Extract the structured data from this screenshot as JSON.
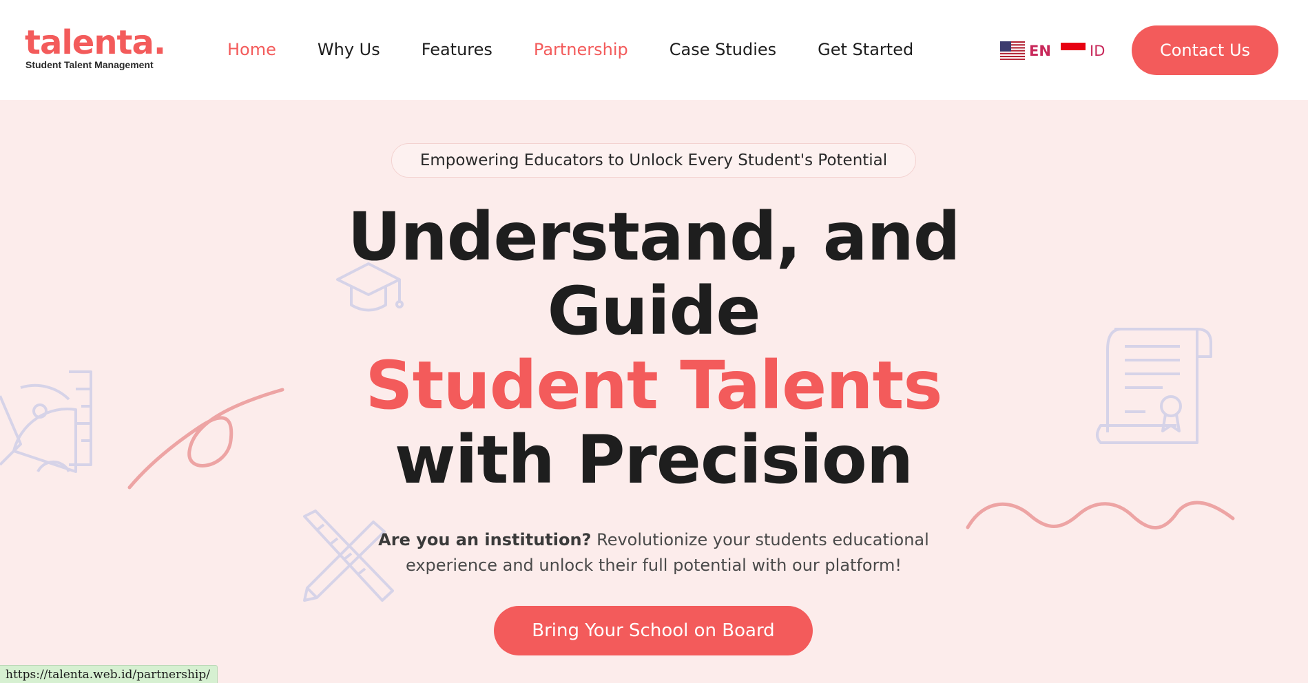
{
  "brand": {
    "name": "talenta.",
    "tagline": "Student Talent Management",
    "accent_color": "#f35b5b",
    "background_color": "#fceceb"
  },
  "nav": {
    "items": [
      {
        "label": "Home",
        "active": true
      },
      {
        "label": "Why Us",
        "active": false
      },
      {
        "label": "Features",
        "active": false
      },
      {
        "label": "Partnership",
        "active": true
      },
      {
        "label": "Case Studies",
        "active": false
      },
      {
        "label": "Get Started",
        "active": false
      }
    ]
  },
  "language": {
    "options": [
      {
        "code": "EN",
        "flag": "us-flag-icon",
        "selected": true
      },
      {
        "code": "ID",
        "flag": "indonesia-flag-icon",
        "selected": false
      }
    ]
  },
  "header": {
    "contact_label": "Contact Us"
  },
  "hero": {
    "pill_text": "Empowering Educators to Unlock Every Student's Potential",
    "headline_line1": "Understand, and",
    "headline_line2": "Guide",
    "headline_accent": "Student Talents",
    "headline_line4": "with Precision",
    "sub_bold": "Are you an institution?",
    "sub_text": " Revolutionize your students educational experience and unlock their full potential with our platform!",
    "cta_label": "Bring Your School on Board"
  },
  "decorations": [
    "protractor-ruler-icon",
    "graduation-cap-icon",
    "pencil-ruler-icon",
    "certificate-scroll-icon",
    "squiggle-line",
    "wave-line"
  ],
  "status_bar": {
    "url": "https://talenta.web.id/partnership/"
  }
}
